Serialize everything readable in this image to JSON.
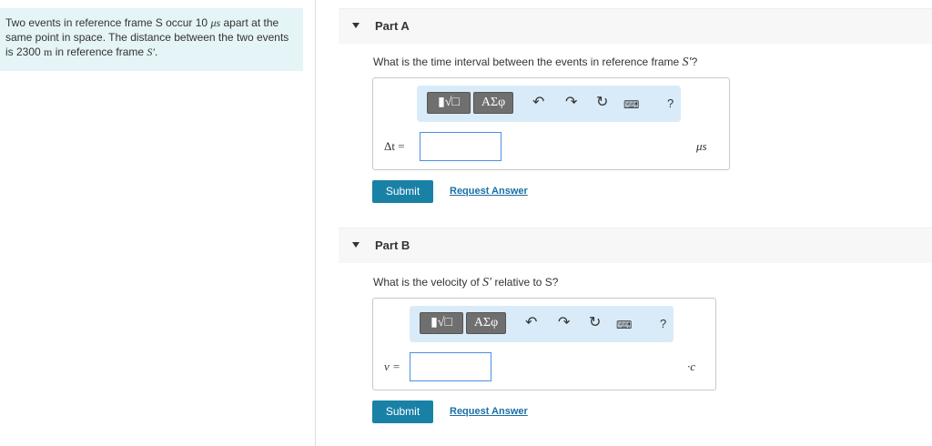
{
  "problem": {
    "text_1": "Two events in reference frame S occur 10 ",
    "time_unit": "μs",
    "text_2": " apart at the same point in space. The distance between the two events is 2300 ",
    "distance_unit": "m",
    "text_3": " in reference frame ",
    "frame": "S′",
    "text_4": "."
  },
  "parts": [
    {
      "title": "Part A",
      "question_prefix": "What is the time interval between the events in reference frame ",
      "question_frame": "S′",
      "question_suffix": "?",
      "toolbar": {
        "template_label": "▮√□",
        "greek_label": "ΑΣφ",
        "help_label": "?"
      },
      "answer_label": "Δt =",
      "answer_value": "",
      "unit": "μs",
      "submit_label": "Submit",
      "request_label": "Request Answer"
    },
    {
      "title": "Part B",
      "question_prefix": "What is the velocity of ",
      "question_frame": "S′",
      "question_suffix": " relative to S?",
      "toolbar": {
        "template_label": "▮√□",
        "greek_label": "ΑΣφ",
        "help_label": "?"
      },
      "answer_label": "v =",
      "answer_value": "",
      "unit": "·c",
      "submit_label": "Submit",
      "request_label": "Request Answer"
    }
  ],
  "icons": {
    "undo": "undo-icon",
    "redo": "redo-icon",
    "reset": "reset-icon",
    "keyboard": "keyboard-icon"
  }
}
